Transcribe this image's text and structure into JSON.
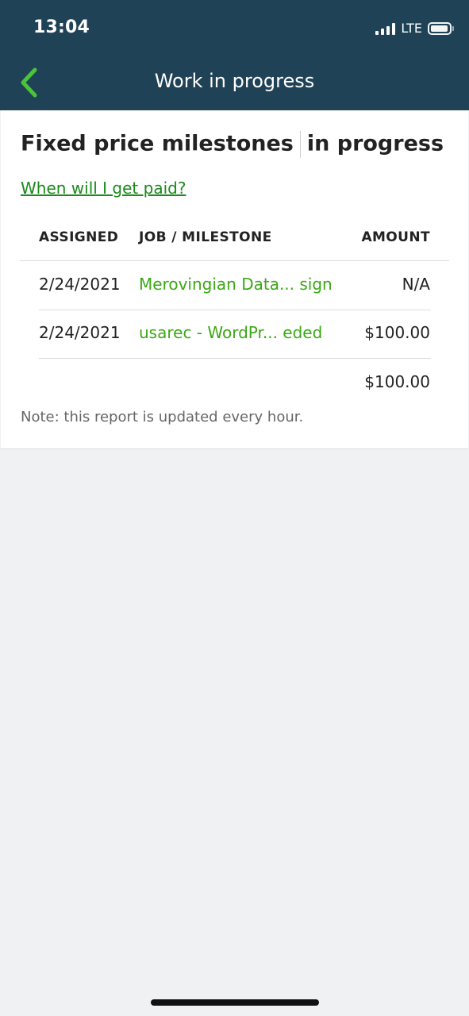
{
  "status_bar": {
    "time": "13:04",
    "network": "LTE"
  },
  "nav": {
    "title": "Work in progress",
    "back_icon": "chevron-left-icon",
    "accent_color": "#4cc43a",
    "background_color": "#1f4256"
  },
  "card": {
    "title_part1": "Fixed price milestones",
    "title_part2": "in progress",
    "paid_link": "When will I get paid?",
    "columns": {
      "assigned": "ASSIGNED",
      "job_milestone": "JOB / MILESTONE",
      "amount": "AMOUNT"
    },
    "rows": [
      {
        "assigned": "2/24/2021",
        "job": "Merovingian Data... sign",
        "amount": "N/A"
      },
      {
        "assigned": "2/24/2021",
        "job": "usarec - WordPr...  eded",
        "amount": "$100.00"
      }
    ],
    "total": "$100.00",
    "note": "Note: this report is updated every hour."
  }
}
